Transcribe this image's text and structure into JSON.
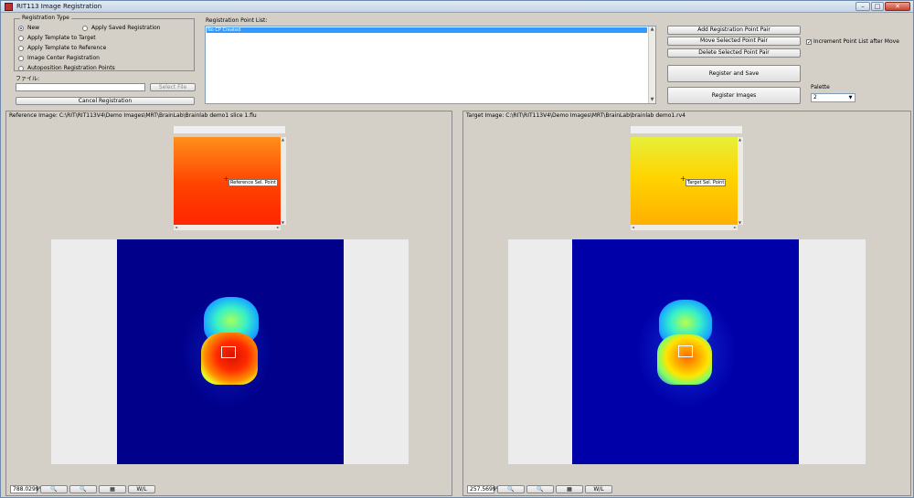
{
  "window": {
    "title": "RIT113 Image Registration",
    "minimize_glyph": "–",
    "maximize_glyph": "□",
    "close_glyph": "✕"
  },
  "registration_type": {
    "legend": "Registration Type",
    "options": [
      {
        "label": "New",
        "selected": true
      },
      {
        "label": "Apply Saved Registration",
        "selected": false
      },
      {
        "label": "Apply Template to Target",
        "selected": false
      },
      {
        "label": "Apply Template to Reference",
        "selected": false
      },
      {
        "label": "Image Center Registration",
        "selected": false
      },
      {
        "label": "Autoposition Registration Points",
        "selected": false
      }
    ]
  },
  "file": {
    "label": "ファイル:",
    "value": "",
    "select_button": "Select File"
  },
  "cancel_button": "Cancel Registration",
  "point_list": {
    "label": "Registration Point List:",
    "items": [
      "No CP Created"
    ]
  },
  "actions": {
    "add_pair": "Add Registration Point Pair",
    "move_pair": "Move Selected Point Pair",
    "delete_pair": "Delete Selected Point Pair",
    "register_save": "Register and Save",
    "register_images": "Register Images"
  },
  "increment": {
    "label": "Increment Point List after Move",
    "checked": true,
    "glyph": "✓"
  },
  "palette": {
    "label": "Palette",
    "value": "2"
  },
  "reference": {
    "label": "Reference Image: C:\\RIT\\RIT113V4\\Demo Images\\MRT\\BrainLab\\Brainlab demo1 slice 1.flu",
    "sel_point_label": "Reference Sel. Point",
    "zoom": "788.0299%",
    "cursor_glyph": "+"
  },
  "target": {
    "label": "Target Image: C:\\RIT\\RIT113V4\\Demo Images\\MRT\\BrainLab\\brainlab demo1.rv4",
    "sel_point_label": "Target Sel. Point",
    "zoom": "257.5699%",
    "cursor_glyph": "+"
  },
  "toolbar": {
    "zoom_in_glyph": "🔍",
    "zoom_out_glyph": "🔍",
    "palette_glyph": "▦",
    "wl_label": "W/L"
  },
  "scroll_glyphs": {
    "up": "▲",
    "down": "▼",
    "left": "◄",
    "right": "►"
  },
  "colors": {
    "selection": "#3399ff",
    "scan_background": "#00008b"
  }
}
